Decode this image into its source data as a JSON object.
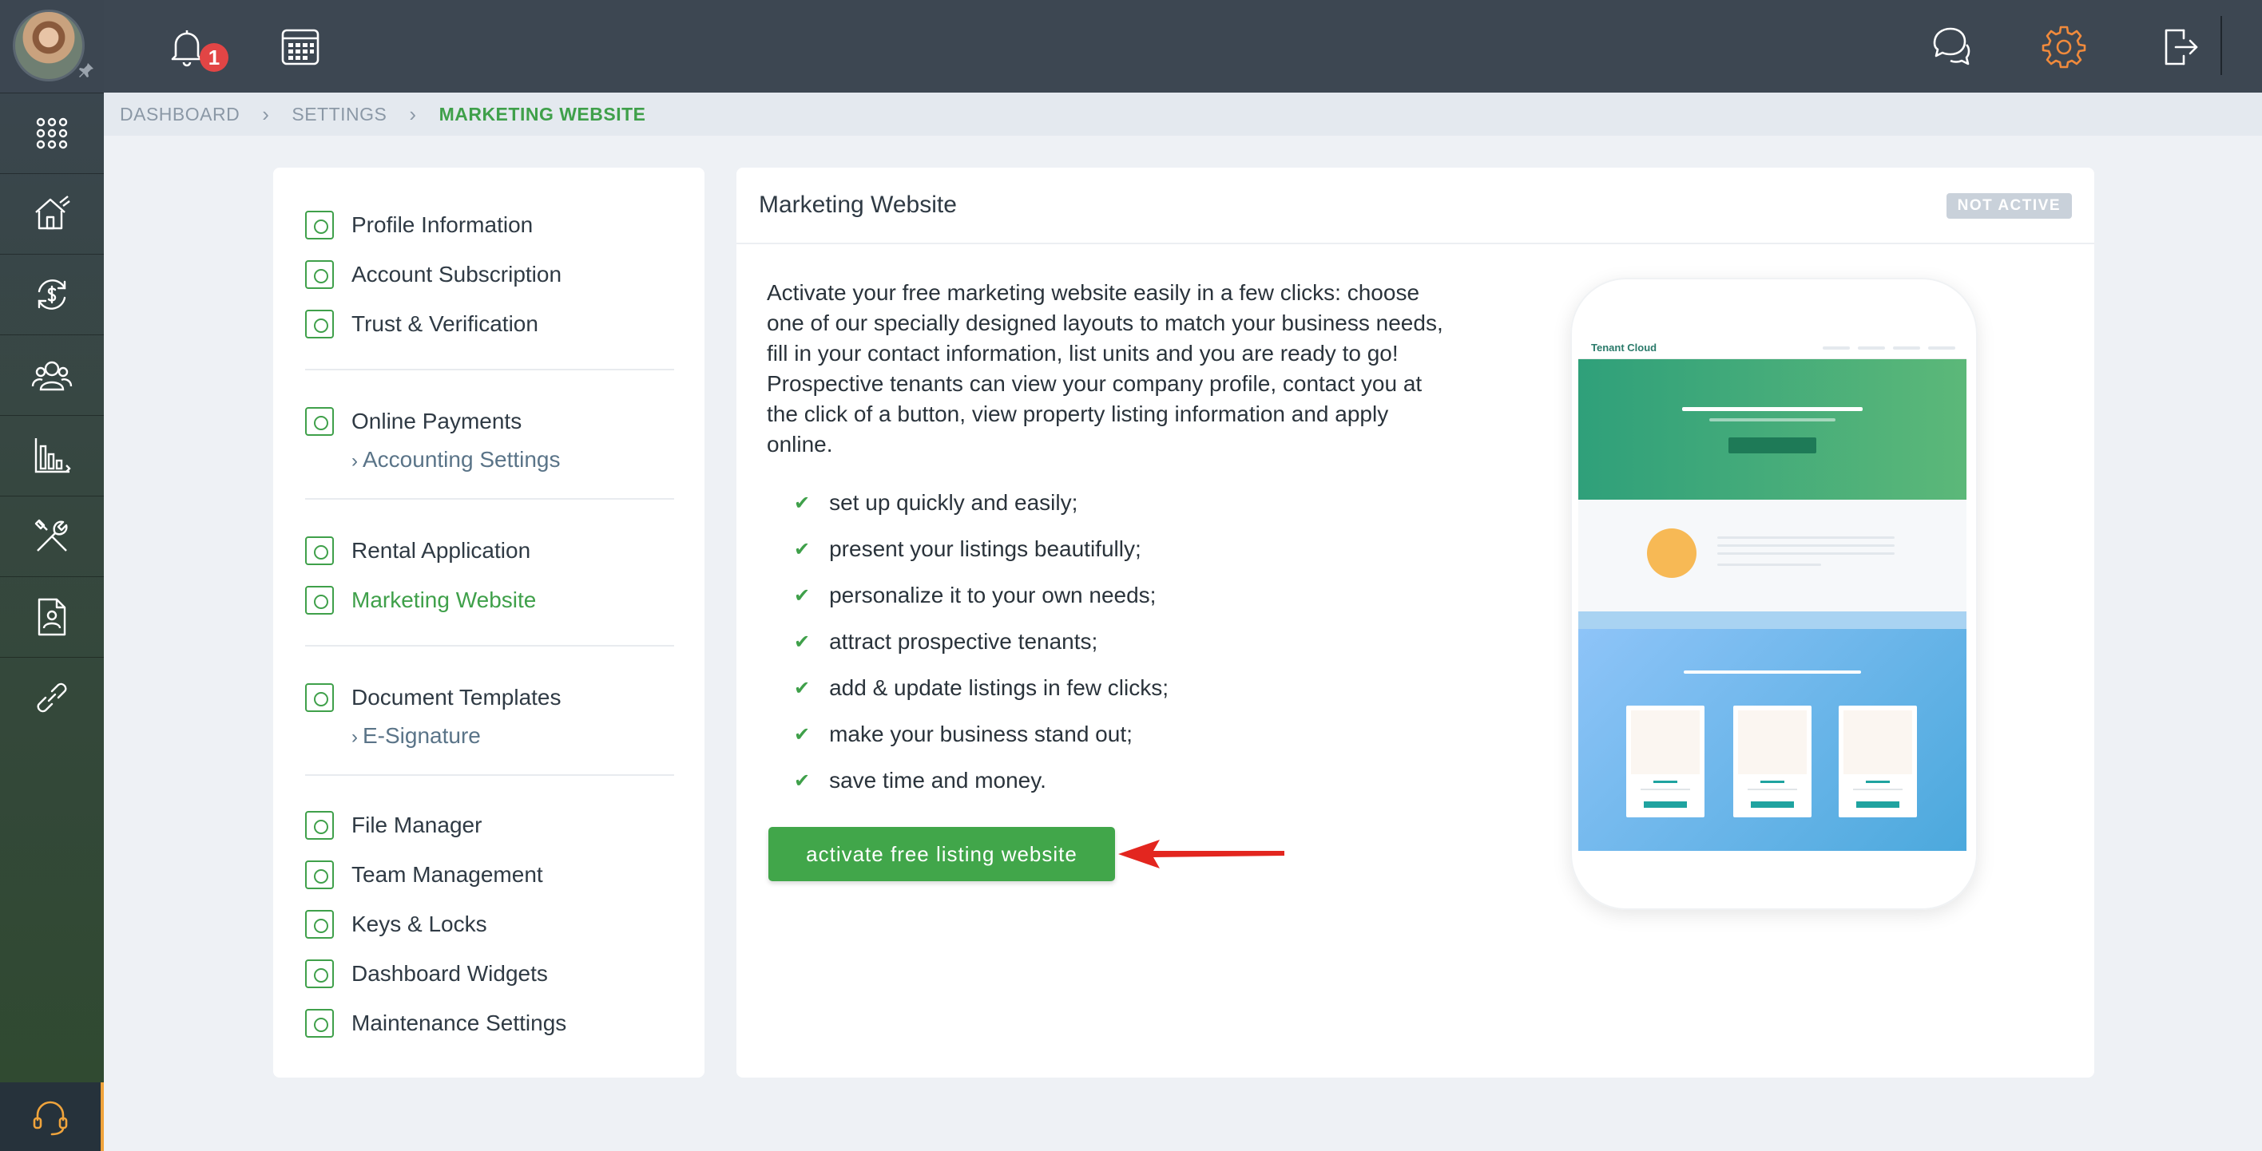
{
  "topbar": {
    "notifications_count": "1",
    "icons": [
      "bell-icon",
      "calendar-icon",
      "chat-icon",
      "gear-icon",
      "logout-icon"
    ],
    "accent_color": "#f08a3c"
  },
  "rail": {
    "items": [
      "apps-grid-icon",
      "properties-icon",
      "transactions-icon",
      "contacts-icon",
      "reports-icon",
      "maintenance-icon",
      "documents-icon",
      "integrations-icon"
    ],
    "support_icon": "headset-icon"
  },
  "breadcrumb": {
    "items": [
      "DASHBOARD",
      "SETTINGS",
      "MARKETING WEBSITE"
    ]
  },
  "menu": {
    "profile_information": "Profile Information",
    "account_subscription": "Account Subscription",
    "trust_verification": "Trust & Verification",
    "online_payments": "Online Payments",
    "accounting_settings": "Accounting Settings",
    "rental_application": "Rental Application",
    "marketing_website": "Marketing Website",
    "document_templates": "Document Templates",
    "e_signature": "E-Signature",
    "file_manager": "File Manager",
    "team_management": "Team Management",
    "keys_locks": "Keys & Locks",
    "dashboard_widgets": "Dashboard Widgets",
    "maintenance_settings": "Maintenance Settings"
  },
  "main": {
    "title": "Marketing Website",
    "status": "NOT ACTIVE",
    "intro": "Activate your free marketing website easily in a few clicks: choose one of our specially designed layouts to match your business needs, fill in your contact information, list units and you are ready to go! Prospective tenants can view your company profile, contact you at the click of a button, view property listing information and apply online.",
    "features": [
      "set up quickly and easily;",
      "present your listings beautifully;",
      "personalize it to your own needs;",
      "attract prospective tenants;",
      "add & update listings in few clicks;",
      "make your business stand out;",
      "save time and money."
    ],
    "cta_label": "activate free listing website",
    "preview_logo": "Tenant Cloud"
  },
  "colors": {
    "brand_green": "#41a64a",
    "topbar": "#3d4752",
    "status_badge": "#c9d1da"
  }
}
